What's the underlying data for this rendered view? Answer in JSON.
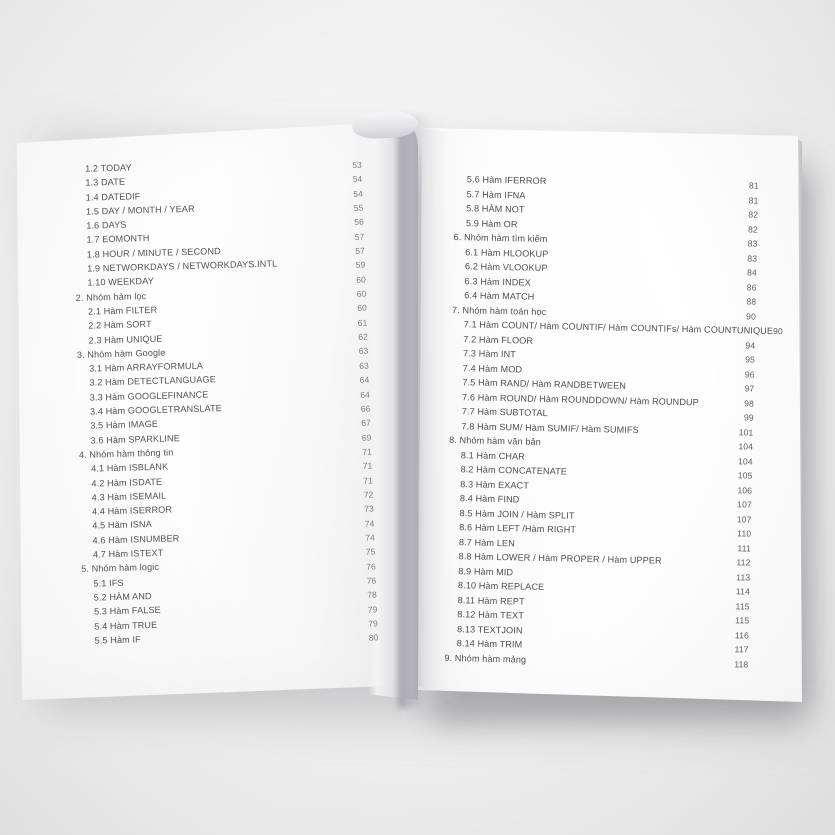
{
  "document": {
    "type": "book-table-of-contents",
    "language": "vi",
    "background_color": "#f2f2f2",
    "page_color": "#ffffff",
    "text_color": "#4a4a50"
  },
  "left_page": {
    "entries": [
      {
        "label": "1.2 TODAY",
        "page": "53",
        "level": 2
      },
      {
        "label": "1.3 DATE",
        "page": "54",
        "level": 2
      },
      {
        "label": "1.4 DATEDIF",
        "page": "54",
        "level": 2
      },
      {
        "label": "1.5 DAY / MONTH / YEAR",
        "page": "55",
        "level": 2
      },
      {
        "label": "1.6 DAYS",
        "page": "56",
        "level": 2
      },
      {
        "label": "1.7 EOMONTH",
        "page": "57",
        "level": 2
      },
      {
        "label": "1.8 HOUR / MINUTE / SECOND",
        "page": "57",
        "level": 2
      },
      {
        "label": "1.9 NETWORKDAYS / NETWORKDAYS.INTL",
        "page": "59",
        "level": 2
      },
      {
        "label": "1.10 WEEKDAY",
        "page": "60",
        "level": 2
      },
      {
        "label": "2. Nhóm hàm lọc",
        "page": "60",
        "level": 1
      },
      {
        "label": "2.1 Hàm FILTER",
        "page": "60",
        "level": 2
      },
      {
        "label": "2.2 Hàm SORT",
        "page": "61",
        "level": 2
      },
      {
        "label": "2.3 Hàm UNIQUE",
        "page": "62",
        "level": 2
      },
      {
        "label": "3. Nhóm hàm Google",
        "page": "63",
        "level": 1
      },
      {
        "label": "3.1 Hàm ARRAYFORMULA",
        "page": "63",
        "level": 2
      },
      {
        "label": "3.2 Hàm DETECTLANGUAGE",
        "page": "64",
        "level": 2
      },
      {
        "label": "3.3 Hàm GOOGLEFINANCE",
        "page": "64",
        "level": 2
      },
      {
        "label": "3.4 Hàm GOOGLETRANSLATE",
        "page": "66",
        "level": 2
      },
      {
        "label": "3.5 Hàm IMAGE",
        "page": "67",
        "level": 2
      },
      {
        "label": "3.6 Hàm SPARKLINE",
        "page": "69",
        "level": 2
      },
      {
        "label": "4. Nhóm hàm thông tin",
        "page": "71",
        "level": 1
      },
      {
        "label": "4.1 Hàm ISBLANK",
        "page": "71",
        "level": 2
      },
      {
        "label": "4.2 Hàm ISDATE",
        "page": "71",
        "level": 2
      },
      {
        "label": "4.3 Hàm ISEMAIL",
        "page": "72",
        "level": 2
      },
      {
        "label": "4.4 Hàm ISERROR",
        "page": "73",
        "level": 2
      },
      {
        "label": "4.5 Hàm ISNA",
        "page": "74",
        "level": 2
      },
      {
        "label": "4.6 Hàm ISNUMBER",
        "page": "74",
        "level": 2
      },
      {
        "label": "4.7 Hàm ISTEXT",
        "page": "75",
        "level": 2
      },
      {
        "label": "5. Nhóm hàm logic",
        "page": "76",
        "level": 1
      },
      {
        "label": "5.1 IFS",
        "page": "76",
        "level": 2
      },
      {
        "label": "5.2 HÀM AND",
        "page": "78",
        "level": 2
      },
      {
        "label": "5.3 Hàm FALSE",
        "page": "79",
        "level": 2
      },
      {
        "label": "5.4 Hàm TRUE",
        "page": "79",
        "level": 2
      },
      {
        "label": "5.5 Hàm IF",
        "page": "80",
        "level": 2
      }
    ]
  },
  "right_page": {
    "entries": [
      {
        "label": "5.6 Hàm IFERROR",
        "page": "81",
        "level": 2
      },
      {
        "label": "5.7 Hàm IFNA",
        "page": "81",
        "level": 2
      },
      {
        "label": "5.8 HÀM NOT",
        "page": "82",
        "level": 2
      },
      {
        "label": "5.9 Hàm OR",
        "page": "82",
        "level": 2
      },
      {
        "label": "6. Nhóm hàm tìm kiếm",
        "page": "83",
        "level": 1
      },
      {
        "label": "6.1 Hàm HLOOKUP",
        "page": "83",
        "level": 2
      },
      {
        "label": "6.2 Hàm VLOOKUP",
        "page": "84",
        "level": 2
      },
      {
        "label": "6.3 Hàm INDEX",
        "page": "86",
        "level": 2
      },
      {
        "label": "6.4 Hàm MATCH",
        "page": "88",
        "level": 2
      },
      {
        "label": "7. Nhóm hàm toán học",
        "page": "90",
        "level": 1
      },
      {
        "label": "7.1 Hàm COUNT/ Hàm COUNTIF/ Hàm COUNTIFs/ Hàm COUNTUNIQUE",
        "page": "90",
        "level": 2,
        "page_inline": true
      },
      {
        "label": "7.2 Hàm FLOOR",
        "page": "94",
        "level": 2
      },
      {
        "label": "7.3 Hàm INT",
        "page": "95",
        "level": 2
      },
      {
        "label": "7.4 Hàm MOD",
        "page": "96",
        "level": 2
      },
      {
        "label": "7.5 Hàm RAND/ Hàm RANDBETWEEN",
        "page": "97",
        "level": 2
      },
      {
        "label": "7.6 Hàm ROUND/ Hàm ROUNDDOWN/ Hàm ROUNDUP",
        "page": "98",
        "level": 2
      },
      {
        "label": "7.7 Hàm SUBTOTAL",
        "page": "99",
        "level": 2
      },
      {
        "label": "7.8 Hàm SUM/ Hàm SUMIF/ Hàm SUMIFS",
        "page": "101",
        "level": 2
      },
      {
        "label": "8. Nhóm hàm văn bản",
        "page": "104",
        "level": 1
      },
      {
        "label": "8.1 Hàm CHAR",
        "page": "104",
        "level": 2
      },
      {
        "label": "8.2 Hàm CONCATENATE",
        "page": "105",
        "level": 2
      },
      {
        "label": "8.3 Hàm EXACT",
        "page": "106",
        "level": 2
      },
      {
        "label": "8.4 Hàm FIND",
        "page": "107",
        "level": 2
      },
      {
        "label": "8.5 Hàm JOIN / Hàm SPLIT",
        "page": "107",
        "level": 2
      },
      {
        "label": "8.6 Hàm LEFT /Hàm RIGHT",
        "page": "110",
        "level": 2
      },
      {
        "label": "8.7 Hàm LEN",
        "page": "111",
        "level": 2
      },
      {
        "label": "8.8 Hàm LOWER / Hàm PROPER / Hàm UPPER",
        "page": "112",
        "level": 2
      },
      {
        "label": "8.9 Hàm MID",
        "page": "113",
        "level": 2
      },
      {
        "label": "8.10 Hàm REPLACE",
        "page": "114",
        "level": 2
      },
      {
        "label": "8.11 Hàm REPT",
        "page": "115",
        "level": 2
      },
      {
        "label": "8.12 Hàm TEXT",
        "page": "115",
        "level": 2
      },
      {
        "label": "8.13 TEXTJOIN",
        "page": "116",
        "level": 2
      },
      {
        "label": "8.14 Hàm TRIM",
        "page": "117",
        "level": 2
      },
      {
        "label": "9. Nhóm hàm mảng",
        "page": "118",
        "level": 1
      }
    ]
  }
}
